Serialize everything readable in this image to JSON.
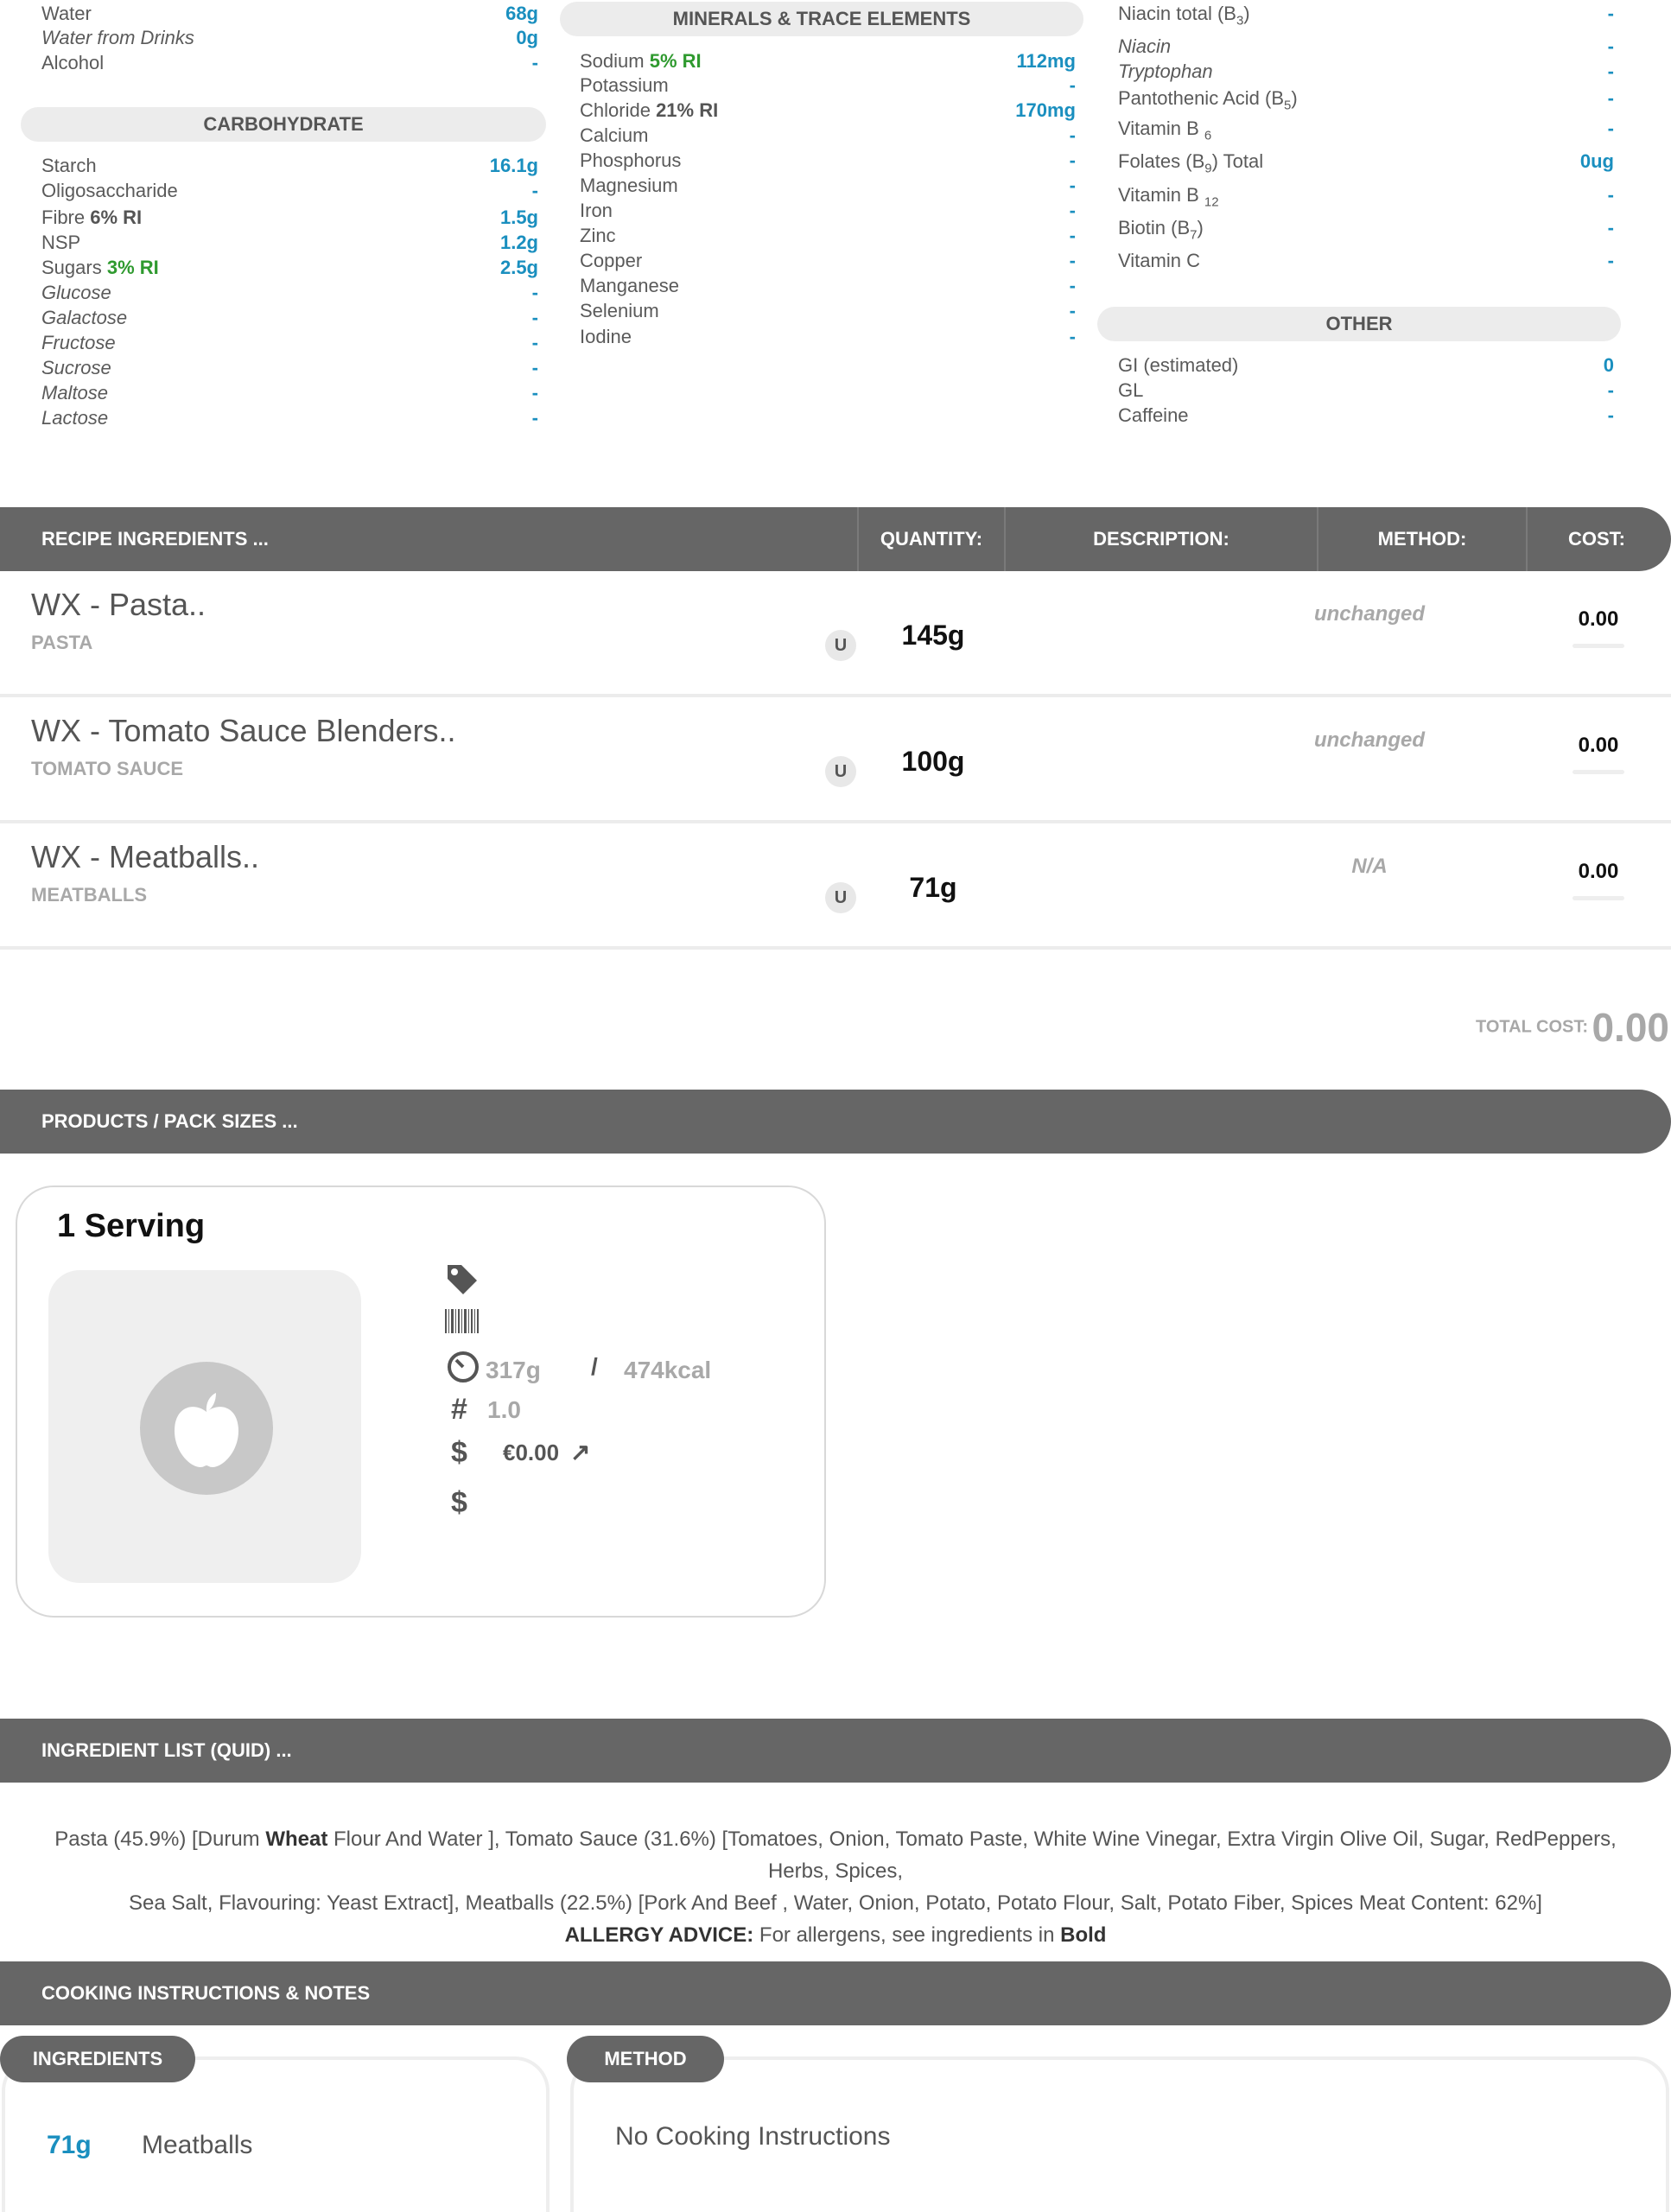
{
  "left_column": {
    "water_rows": [
      {
        "label": "Water",
        "value": "68g",
        "italic": false
      },
      {
        "label": "Water from Drinks",
        "value": "0g",
        "italic": true
      },
      {
        "label": "Alcohol",
        "value": "-",
        "italic": false
      }
    ],
    "carb_header": "CARBOHYDRATE",
    "carb_rows": [
      {
        "label": "Starch",
        "value": "16.1g",
        "italic": false,
        "ri": ""
      },
      {
        "label": "Oligosaccharide",
        "value": "-",
        "italic": false,
        "ri": ""
      },
      {
        "label": "Fibre",
        "value": "1.5g",
        "italic": false,
        "ri": "6% RI"
      },
      {
        "label": "NSP",
        "value": "1.2g",
        "italic": false,
        "ri": ""
      },
      {
        "label": "Sugars",
        "value": "2.5g",
        "italic": false,
        "ri": "3% RI"
      },
      {
        "label": "Glucose",
        "value": "-",
        "italic": true,
        "ri": ""
      },
      {
        "label": "Galactose",
        "value": "-",
        "italic": true,
        "ri": ""
      },
      {
        "label": "Fructose",
        "value": "-",
        "italic": true,
        "ri": ""
      },
      {
        "label": "Sucrose",
        "value": "-",
        "italic": true,
        "ri": ""
      },
      {
        "label": "Maltose",
        "value": "-",
        "italic": true,
        "ri": ""
      },
      {
        "label": "Lactose",
        "value": "-",
        "italic": true,
        "ri": ""
      }
    ]
  },
  "middle_column": {
    "header": "MINERALS & TRACE ELEMENTS",
    "rows": [
      {
        "label": "Sodium",
        "value": "112mg",
        "ri": "5% RI",
        "ri_color": "green"
      },
      {
        "label": "Potassium",
        "value": "-",
        "ri": "",
        "ri_color": ""
      },
      {
        "label": "Chloride",
        "value": "170mg",
        "ri": "21% RI",
        "ri_color": "dark"
      },
      {
        "label": "Calcium",
        "value": "-",
        "ri": "",
        "ri_color": ""
      },
      {
        "label": "Phosphorus",
        "value": "-",
        "ri": "",
        "ri_color": ""
      },
      {
        "label": "Magnesium",
        "value": "-",
        "ri": "",
        "ri_color": ""
      },
      {
        "label": "Iron",
        "value": "-",
        "ri": "",
        "ri_color": ""
      },
      {
        "label": "Zinc",
        "value": "-",
        "ri": "",
        "ri_color": ""
      },
      {
        "label": "Copper",
        "value": "-",
        "ri": "",
        "ri_color": ""
      },
      {
        "label": "Manganese",
        "value": "-",
        "ri": "",
        "ri_color": ""
      },
      {
        "label": "Selenium",
        "value": "-",
        "ri": "",
        "ri_color": ""
      },
      {
        "label": "Iodine",
        "value": "-",
        "ri": "",
        "ri_color": ""
      }
    ]
  },
  "right_column": {
    "vitamin_rows": [
      {
        "label": "Niacin total (B",
        "sub": "3",
        "suffix": ")",
        "value": "-",
        "italic": false
      },
      {
        "label": "Niacin",
        "sub": "",
        "suffix": "",
        "value": "-",
        "italic": true
      },
      {
        "label": "Tryptophan",
        "sub": "",
        "suffix": "",
        "value": "-",
        "italic": true
      },
      {
        "label": "Pantothenic Acid (B",
        "sub": "5",
        "suffix": ")",
        "value": "-",
        "italic": false
      },
      {
        "label": "Vitamin B ",
        "sub": "6",
        "suffix": "",
        "value": "-",
        "italic": false
      },
      {
        "label": "Folates (B",
        "sub": "9",
        "suffix": ") Total",
        "value": "0ug",
        "italic": false
      },
      {
        "label": "Vitamin B ",
        "sub": "12",
        "suffix": "",
        "value": "-",
        "italic": false
      },
      {
        "label": "Biotin (B",
        "sub": "7",
        "suffix": ")",
        "value": "-",
        "italic": false
      },
      {
        "label": "Vitamin C",
        "sub": "",
        "suffix": "",
        "value": "-",
        "italic": false
      }
    ],
    "other_header": "OTHER",
    "other_rows": [
      {
        "label": "GI (estimated)",
        "value": "0"
      },
      {
        "label": "GL",
        "value": "-"
      },
      {
        "label": "Caffeine",
        "value": "-"
      }
    ]
  },
  "recipe": {
    "headers": {
      "ingredients": "RECIPE INGREDIENTS ...",
      "quantity": "QUANTITY:",
      "description": "DESCRIPTION:",
      "method": "METHOD:",
      "cost": "COST:"
    },
    "rows": [
      {
        "name": "WX - Pasta..",
        "category": "PASTA",
        "unit": "U",
        "quantity": "145g",
        "method": "unchanged",
        "cost": "0.00"
      },
      {
        "name": "WX - Tomato Sauce Blenders..",
        "category": "TOMATO SAUCE",
        "unit": "U",
        "quantity": "100g",
        "method": "unchanged",
        "cost": "0.00"
      },
      {
        "name": "WX - Meatballs..",
        "category": "MEATBALLS",
        "unit": "U",
        "quantity": "71g",
        "method": "N/A",
        "cost": "0.00"
      }
    ],
    "total_label": "TOTAL COST:",
    "total_value": "0.00"
  },
  "products": {
    "header": "PRODUCTS / PACK SIZES ...",
    "card": {
      "title": "1 Serving",
      "weight": "317g",
      "divider": "/",
      "energy": "474kcal",
      "count": "1.0",
      "price": "€0.00",
      "icons": [
        "tag-icon",
        "barcode-icon",
        "weight-icon",
        "hash-icon",
        "dollar-icon",
        "dollar-icon",
        "apple-icon",
        "external-link-icon"
      ]
    }
  },
  "quid": {
    "header": "INGREDIENT LIST (QUID) ...",
    "line1_a": "Pasta (45.9%) [Durum ",
    "line1_bold": "Wheat",
    "line1_b": " Flour And Water ], Tomato Sauce (31.6%) [Tomatoes, Onion, Tomato Paste, White Wine Vinegar, Extra Virgin Olive Oil, Sugar, RedPeppers, Herbs, Spices,",
    "line2": "Sea Salt, Flavouring: Yeast Extract], Meatballs (22.5%) [Pork And Beef , Water, Onion, Potato, Potato Flour, Salt, Potato Fiber, Spices Meat Content: 62%]",
    "allergy_label": "ALLERGY ADVICE:",
    "allergy_text": " For allergens, see ingredients in ",
    "allergy_bold": "Bold"
  },
  "cooking": {
    "header": "COOKING INSTRUCTIONS & NOTES",
    "ingredients_tab": "INGREDIENTS",
    "method_tab": "METHOD",
    "ingredient_qty": "71g",
    "ingredient_name": "Meatballs",
    "method_text": "No Cooking Instructions"
  },
  "colors": {
    "accent_blue": "#1a8fbf",
    "ri_green": "#2f9a2f",
    "bar_gray": "#666666"
  }
}
